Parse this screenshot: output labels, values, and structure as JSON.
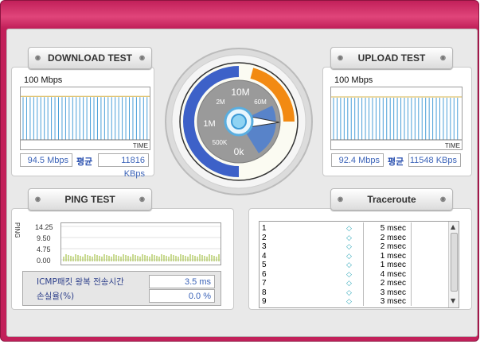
{
  "download": {
    "title": "DOWNLOAD TEST",
    "scale_label": "100 Mbps",
    "axis_label": "TIME",
    "speed": "94.5 Mbps",
    "avg_label": "평균",
    "avg_value": "11816 KBps",
    "level_fraction": 0.945
  },
  "upload": {
    "title": "UPLOAD TEST",
    "scale_label": "100 Mbps",
    "axis_label": "TIME",
    "speed": "92.4 Mbps",
    "avg_label": "평균",
    "avg_value": "11548 KBps",
    "level_fraction": 0.924
  },
  "gauge": {
    "labels": [
      "10M",
      "2M",
      "60M",
      "1M",
      "500K",
      "0k"
    ]
  },
  "ping": {
    "title": "PING TEST",
    "axis_label": "PING",
    "y_ticks": [
      "14.25",
      "9.50",
      "4.75",
      "0.00"
    ],
    "icmp_label": "ICMP패킷 왕복 전송시간",
    "icmp_value": "3.5 ms",
    "loss_label": "손실율(%)",
    "loss_value": "0.0 %"
  },
  "traceroute": {
    "title": "Traceroute",
    "rows": [
      {
        "hop": "1",
        "time": "5 msec"
      },
      {
        "hop": "2",
        "time": "2 msec"
      },
      {
        "hop": "3",
        "time": "2 msec"
      },
      {
        "hop": "4",
        "time": "1 msec"
      },
      {
        "hop": "5",
        "time": "1 msec"
      },
      {
        "hop": "6",
        "time": "4 msec"
      },
      {
        "hop": "7",
        "time": "2 msec"
      },
      {
        "hop": "8",
        "time": "3 msec"
      },
      {
        "hop": "9",
        "time": "3 msec"
      }
    ]
  },
  "colors": {
    "frame": "#c2205a",
    "bar": "#4a9fd8",
    "level_line": "#d7b44a",
    "gauge_blue": "#3d61c8",
    "gauge_orange": "#f28a12",
    "ping_bar": "#a5c24a",
    "value_text": "#3b63b8"
  }
}
